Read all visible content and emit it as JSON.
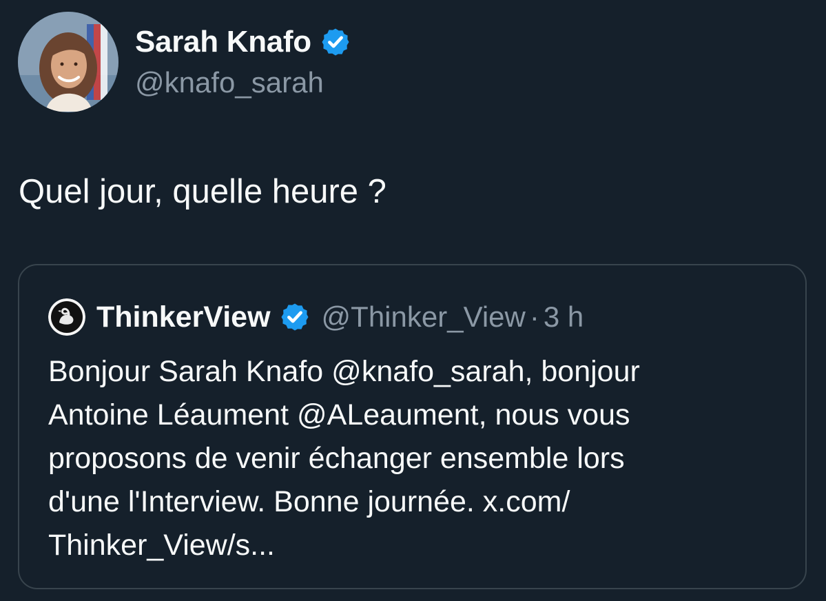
{
  "tweet": {
    "author_name": "Sarah Knafo",
    "author_handle": "@knafo_sarah",
    "text": "Quel jour, quelle heure ?",
    "verified_icon": "verified-badge-icon"
  },
  "quoted_tweet": {
    "author_name": "ThinkerView",
    "author_handle": "@Thinker_View",
    "separator": "·",
    "time": "3 h",
    "avatar_icon": "swan-logo-icon",
    "verified_icon": "verified-badge-icon",
    "lines": [
      "Bonjour Sarah Knafo @knafo_sarah, bonjour",
      "Antoine Léaument @ALeaument, nous vous",
      "proposons de venir échanger ensemble lors",
      "d'une l'Interview. Bonne journée. x.com/",
      "Thinker_View/s..."
    ]
  },
  "colors": {
    "background": "#15202b",
    "primary_text": "#f7f9f9",
    "secondary_text": "#8b98a5",
    "border": "#38444d",
    "verified_blue": "#1d9bf0"
  }
}
